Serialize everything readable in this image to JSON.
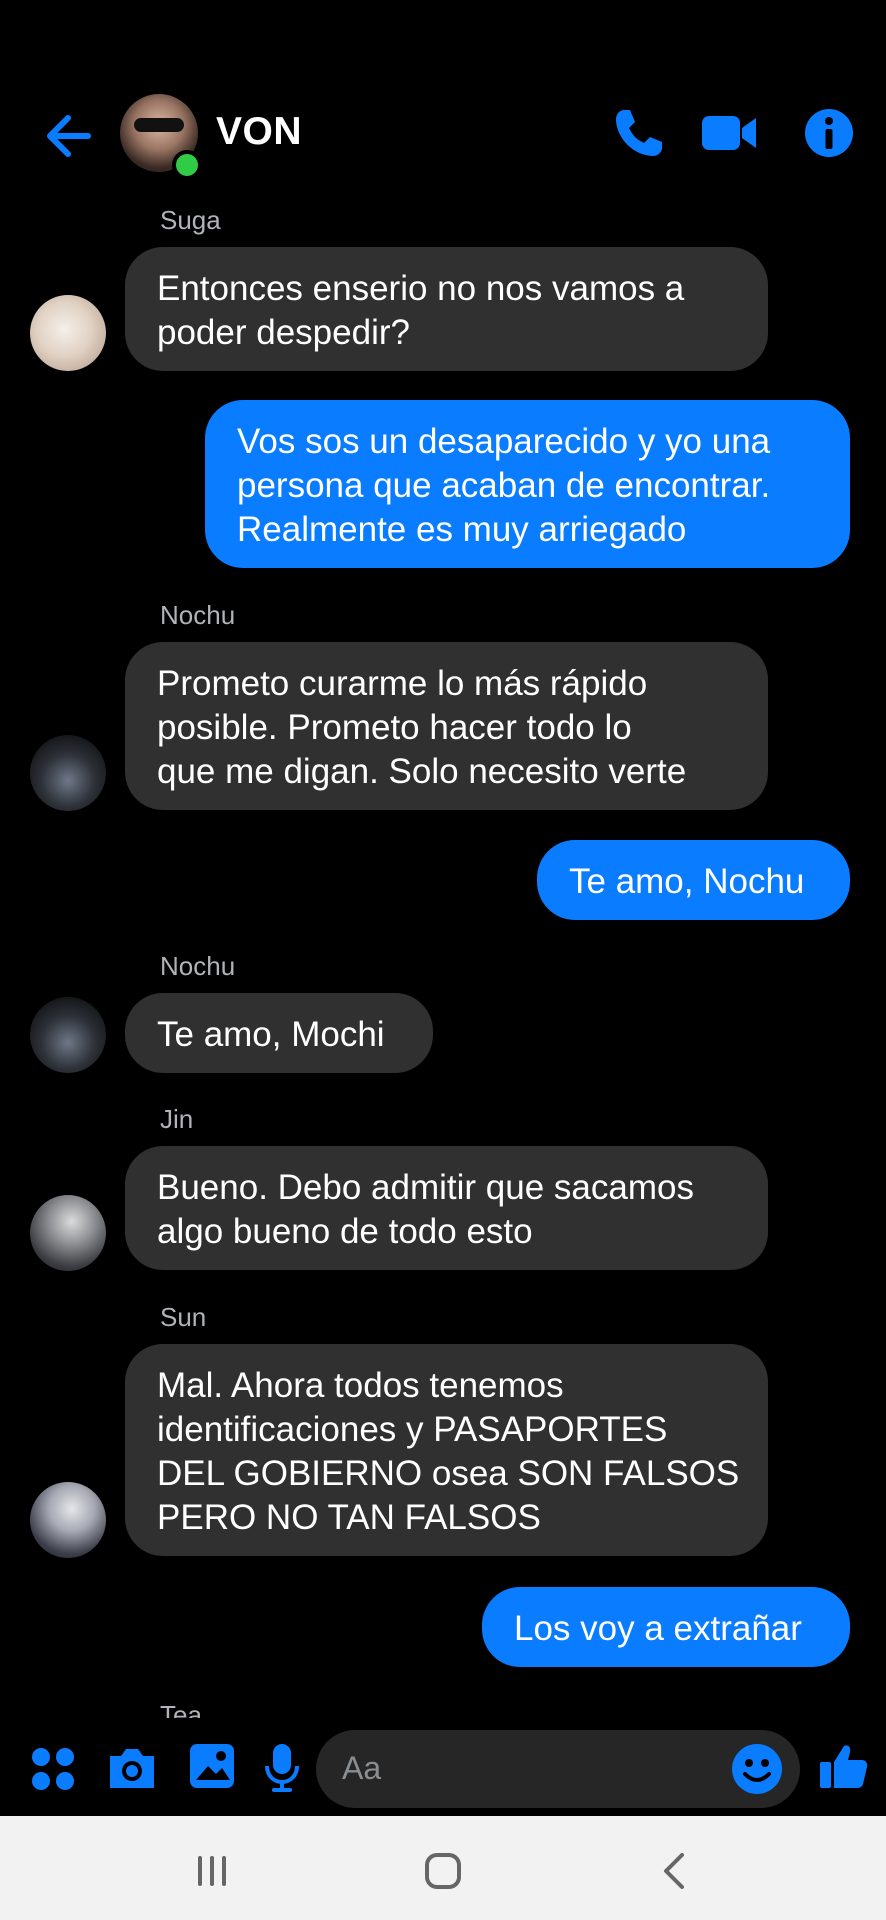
{
  "header": {
    "title": "VON",
    "icons": [
      "back-arrow-icon",
      "phone-icon",
      "video-camera-icon",
      "info-icon"
    ]
  },
  "messages": [
    {
      "direction": "in",
      "sender": "Suga",
      "lines": [
        "Entonces enserio no nos vamos a",
        "poder despedir?"
      ]
    },
    {
      "direction": "out",
      "lines": [
        "Vos sos un desaparecido y yo una",
        "persona que acaban de encontrar.",
        "Realmente es muy arriegado"
      ]
    },
    {
      "direction": "in",
      "sender": "Nochu",
      "lines": [
        "Prometo curarme lo más rápido",
        "posible. Prometo hacer todo lo",
        "que me digan. Solo necesito verte"
      ]
    },
    {
      "direction": "out",
      "lines": [
        "Te amo, Nochu"
      ]
    },
    {
      "direction": "in",
      "sender": "Nochu",
      "lines": [
        "Te amo, Mochi"
      ]
    },
    {
      "direction": "in",
      "sender": "Jin",
      "lines": [
        "Bueno. Debo admitir que sacamos",
        "algo bueno de todo esto"
      ]
    },
    {
      "direction": "in",
      "sender": "Sun",
      "lines": [
        "Mal. Ahora todos tenemos",
        "identificaciones y PASAPORTES",
        "DEL GOBIERNO osea SON FALSOS",
        "PERO NO TAN FALSOS"
      ]
    },
    {
      "direction": "out",
      "lines": [
        "Los voy a extrañar"
      ]
    }
  ],
  "partial_sender": "Tea",
  "composer": {
    "placeholder": "Aa",
    "icons": [
      "apps-grid-icon",
      "camera-icon",
      "gallery-icon",
      "microphone-icon",
      "emoji-icon",
      "thumbs-up-icon"
    ]
  },
  "navbar": {
    "icons": [
      "recent-apps-icon",
      "home-icon",
      "back-nav-icon"
    ]
  },
  "colors": {
    "accent": "#0a7cff",
    "incoming_bubble": "#303030",
    "online": "#31cc46",
    "background": "#000000"
  }
}
